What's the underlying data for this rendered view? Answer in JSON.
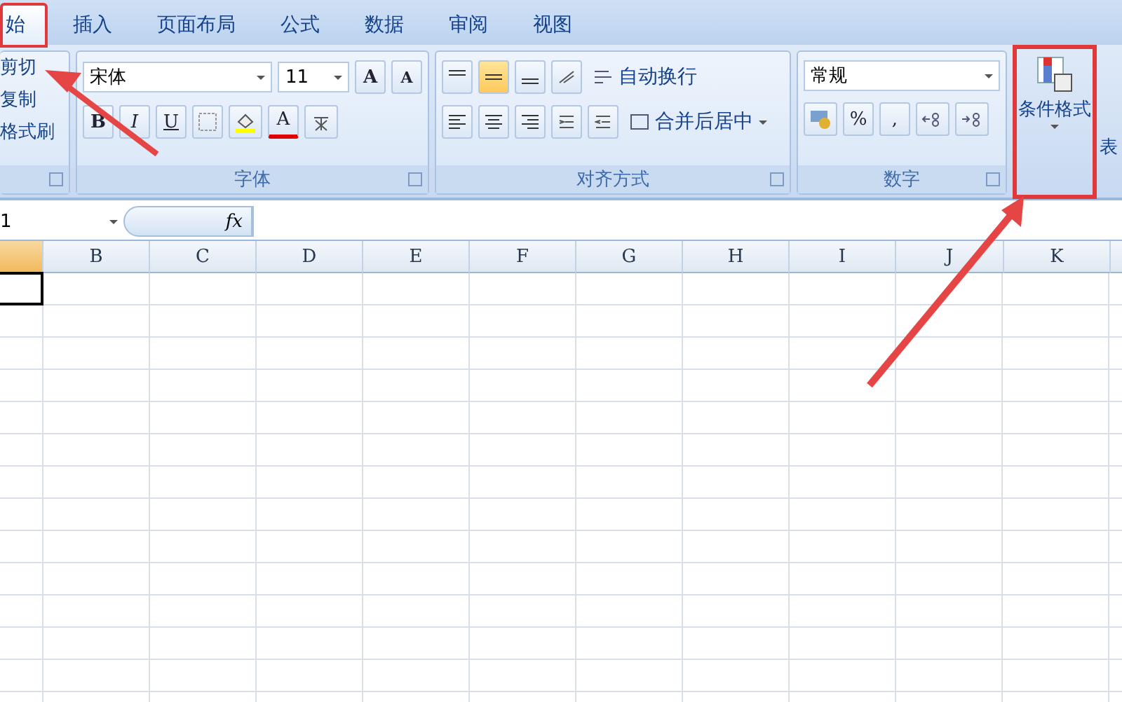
{
  "tabs": [
    {
      "label": "始",
      "selected": true,
      "highlighted": true
    },
    {
      "label": "插入",
      "selected": false,
      "highlighted": false
    },
    {
      "label": "页面布局",
      "selected": false,
      "highlighted": false
    },
    {
      "label": "公式",
      "selected": false,
      "highlighted": false
    },
    {
      "label": "数据",
      "selected": false,
      "highlighted": false
    },
    {
      "label": "审阅",
      "selected": false,
      "highlighted": false
    },
    {
      "label": "视图",
      "selected": false,
      "highlighted": false
    }
  ],
  "clipboard": {
    "items": [
      "剪切",
      "复制",
      "格式刷"
    ]
  },
  "font": {
    "label": "字体",
    "font_name": "宋体",
    "font_size": "11",
    "grow": "A",
    "shrink": "A",
    "styles": [
      "B",
      "I",
      "U"
    ],
    "font_color": "A"
  },
  "alignment": {
    "label": "对齐方式",
    "vertical": [
      {
        "selected": false
      },
      {
        "selected": true
      },
      {
        "selected": false
      }
    ],
    "wrap_text": "自动换行",
    "merge": "合并后居中"
  },
  "number": {
    "label": "数字",
    "format": "常规",
    "percent": "%",
    "comma": ","
  },
  "styles": {
    "conditional": "条件格式",
    "cut_label": "表"
  },
  "formula_bar": {
    "name_box": "1",
    "fx": "fx"
  },
  "first_column": {
    "selected": true
  },
  "columns": [
    {
      "label": "B",
      "selected": false
    },
    {
      "label": "C",
      "selected": false
    },
    {
      "label": "D",
      "selected": false
    },
    {
      "label": "E",
      "selected": false
    },
    {
      "label": "F",
      "selected": false
    },
    {
      "label": "G",
      "selected": false
    },
    {
      "label": "H",
      "selected": false
    },
    {
      "label": "I",
      "selected": false
    },
    {
      "label": "J",
      "selected": false
    },
    {
      "label": "K",
      "selected": false
    }
  ]
}
